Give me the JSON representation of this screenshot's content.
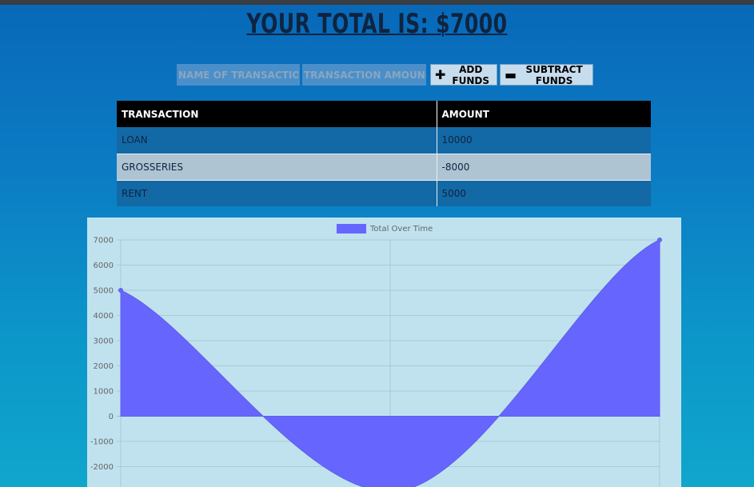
{
  "header": {
    "title": "Your Total is: $7000"
  },
  "form": {
    "name_placeholder": "Name of transaction",
    "amount_placeholder": "Transaction Amount",
    "add_label": "Add Funds",
    "subtract_label": "Subtract Funds"
  },
  "table": {
    "columns": [
      "Transaction",
      "Amount"
    ],
    "rows": [
      {
        "name": "Loan",
        "amount": "10000"
      },
      {
        "name": "Grosseries",
        "amount": "-8000"
      },
      {
        "name": "Rent",
        "amount": "5000"
      }
    ]
  },
  "colors": {
    "series_fill": "#6666ff",
    "series_line": "#5f5fe8"
  },
  "chart_data": {
    "type": "area",
    "title": "",
    "legend": "top-center",
    "series": [
      {
        "name": "Total Over Time",
        "values": [
          5000,
          -3000,
          7000
        ]
      }
    ],
    "y_ticks": [
      "7000",
      "6000",
      "5000",
      "4000",
      "3000",
      "2000",
      "1000",
      "0",
      "-1000",
      "-2000"
    ],
    "ylim": [
      -3000,
      7000
    ],
    "grid": true
  }
}
